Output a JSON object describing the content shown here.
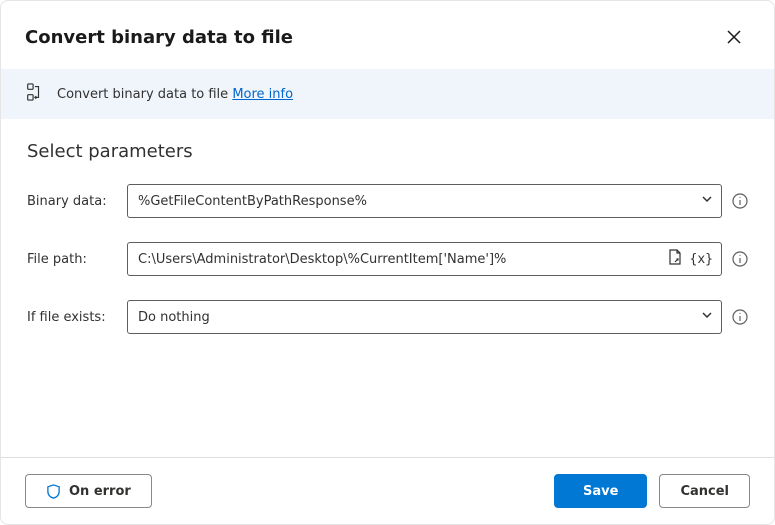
{
  "header": {
    "title": "Convert binary data to file"
  },
  "banner": {
    "text": "Convert binary data to file",
    "link_label": "More info"
  },
  "section": {
    "title": "Select parameters"
  },
  "fields": {
    "binary_data": {
      "label": "Binary data:",
      "value": "%GetFileContentByPathResponse%"
    },
    "file_path": {
      "label": "File path:",
      "value": "C:\\Users\\Administrator\\Desktop\\%CurrentItem['Name']%"
    },
    "if_exists": {
      "label": "If file exists:",
      "value": "Do nothing"
    }
  },
  "footer": {
    "on_error": "On error",
    "save": "Save",
    "cancel": "Cancel"
  }
}
